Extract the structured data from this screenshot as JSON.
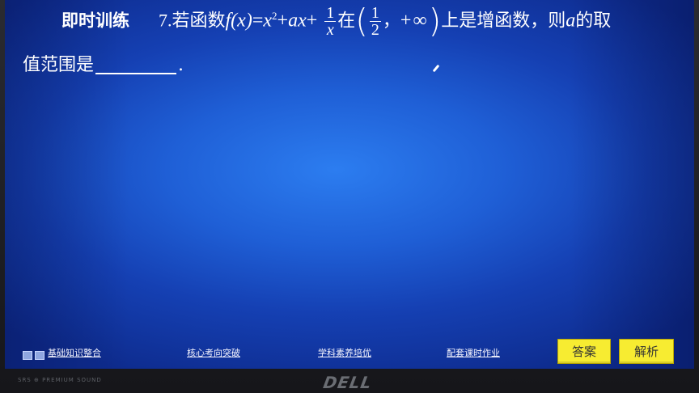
{
  "question": {
    "section_title": "即时训练",
    "number": "7.",
    "text_prefix": "若函数",
    "fx": "f(x)",
    "equals": "=",
    "x_term": "x",
    "x_exp": "2",
    "plus1": "+",
    "ax_term": "ax",
    "plus2": "+",
    "frac1_num": "1",
    "frac1_den": "x",
    "zai": "在",
    "interval_open": "(",
    "frac2_num": "1",
    "frac2_den": "2",
    "comma": "，",
    "plus_inf": "+∞",
    "interval_close": ")",
    "text_suffix": "上是增函数，则",
    "a_var": "a",
    "text_end": "的取",
    "line2_text": "值范围是",
    "period": "."
  },
  "nav": {
    "link1": "基础知识整合",
    "link2": "核心考向突破",
    "link3": "学科素养培优",
    "link4": "配套课时作业"
  },
  "buttons": {
    "answer": "答案",
    "analysis": "解析"
  },
  "bezel": {
    "brand": "DELL",
    "sound_label": "SRS ⊕ PREMIUM SOUND"
  }
}
